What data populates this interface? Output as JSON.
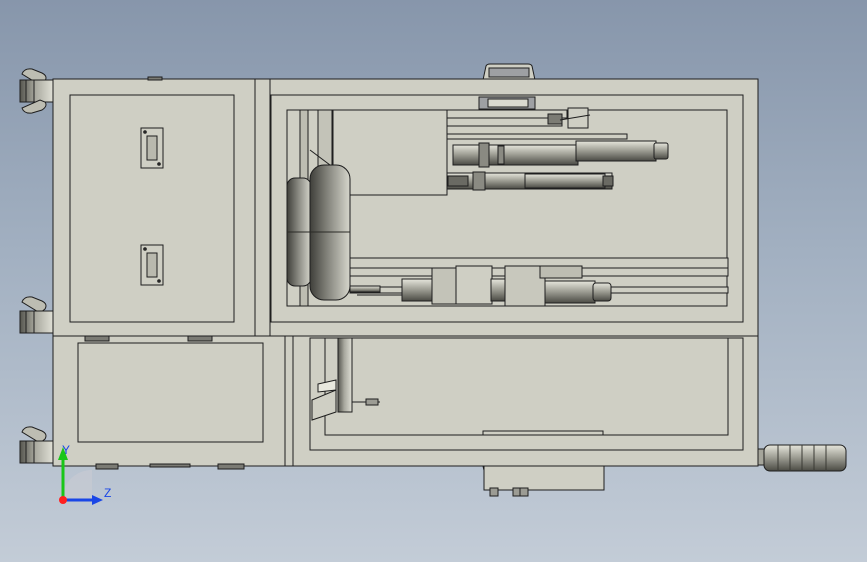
{
  "viewport": {
    "background_top": "#8796ab",
    "background_bottom": "#c3ccd7"
  },
  "model": {
    "view": "top view",
    "part_fill": "#cfcfc4",
    "part_stroke": "#1e1e1e",
    "shadow_fill": "#55554e"
  },
  "triad": {
    "x_color": "#ff2020",
    "y_color": "#19c619",
    "z_color": "#1a46e6",
    "y_label": "Y",
    "z_label": "Z"
  }
}
